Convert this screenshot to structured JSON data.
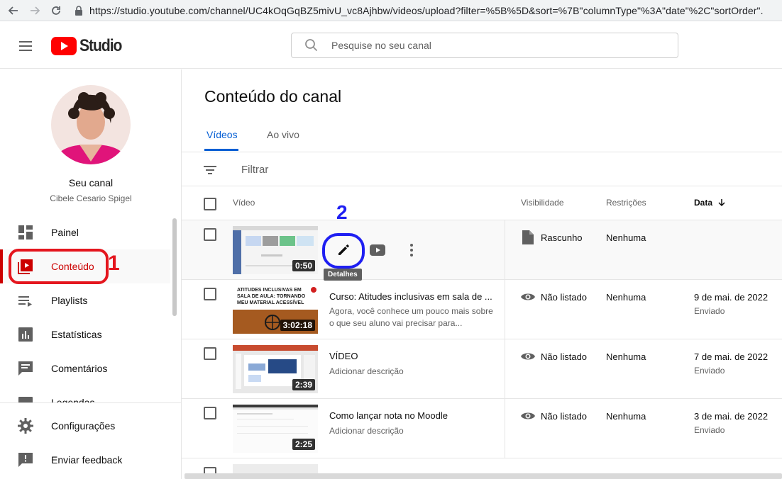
{
  "browser": {
    "url": "https://studio.youtube.com/channel/UC4kOqGqBZ5mivU_vc8Ajhbw/videos/upload?filter=%5B%5D&sort=%7B\"columnType\"%3A\"date\"%2C\"sortOrder\"..."
  },
  "header": {
    "logo_text": "Studio",
    "search_placeholder": "Pesquise no seu canal"
  },
  "sidebar": {
    "channel_label": "Seu canal",
    "channel_name": "Cibele Cesario Spigel",
    "items": [
      {
        "label": "Painel",
        "icon": "dashboard-icon"
      },
      {
        "label": "Conteúdo",
        "icon": "content-icon",
        "active": true
      },
      {
        "label": "Playlists",
        "icon": "playlists-icon"
      },
      {
        "label": "Estatísticas",
        "icon": "analytics-icon"
      },
      {
        "label": "Comentários",
        "icon": "comments-icon"
      },
      {
        "label": "Legendas",
        "icon": "subtitles-icon"
      }
    ],
    "bottom": [
      {
        "label": "Configurações",
        "icon": "gear-icon"
      },
      {
        "label": "Enviar feedback",
        "icon": "feedback-icon"
      }
    ]
  },
  "annotations": {
    "step1": "1",
    "step2": "2"
  },
  "main": {
    "title": "Conteúdo do canal",
    "tabs": [
      {
        "label": "Vídeos"
      },
      {
        "label": "Ao vivo"
      }
    ],
    "filter_label": "Filtrar",
    "columns": {
      "video": "Vídeo",
      "visibility": "Visibilidade",
      "restrictions": "Restrições",
      "date": "Data"
    },
    "tooltip": "Detalhes",
    "rows": [
      {
        "duration": "0:50",
        "visibility": "Rascunho",
        "restrictions": "Nenhuma"
      },
      {
        "duration": "3:02:18",
        "title": "Curso: Atitudes inclusivas em sala de ...",
        "description": "Agora, você conhece um pouco mais sobre o que seu aluno vai precisar para...",
        "visibility": "Não listado",
        "restrictions": "Nenhuma",
        "date": "9 de mai. de 2022",
        "status": "Enviado",
        "thumb_text": "ATITUDES INCLUSIVAS EM SALA DE AULA: TORNANDO MEU MATERIAL ACESSÍVEL"
      },
      {
        "duration": "2:39",
        "title": "VÍDEO",
        "description": "Adicionar descrição",
        "visibility": "Não listado",
        "restrictions": "Nenhuma",
        "date": "7 de mai. de 2022",
        "status": "Enviado"
      },
      {
        "duration": "2:25",
        "title": "Como lançar nota no Moodle",
        "description": "Adicionar descrição",
        "visibility": "Não listado",
        "restrictions": "Nenhuma",
        "date": "3 de mai. de 2022",
        "status": "Enviado"
      }
    ]
  },
  "colors": {
    "brand_red": "#ff0000",
    "active_red": "#cc0000",
    "link_blue": "#065fd4",
    "annotation_red": "#e4161e",
    "annotation_blue": "#1f1ff2"
  }
}
